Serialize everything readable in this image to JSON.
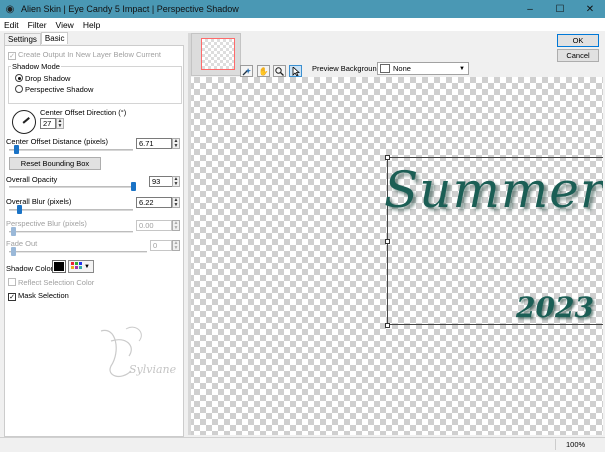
{
  "window": {
    "title": "Alien Skin | Eye Candy 5 Impact | Perspective Shadow",
    "minimize_icon": "minimize-icon",
    "maximize_icon": "maximize-icon",
    "close_icon": "close-icon"
  },
  "menu": {
    "items": [
      "Edit",
      "Filter",
      "View",
      "Help"
    ]
  },
  "tabs": [
    "Settings",
    "Basic"
  ],
  "basic": {
    "create_output_label": "Create Output In New Layer Below Current",
    "shadow_mode_label": "Shadow Mode",
    "drop_shadow_label": "Drop Shadow",
    "perspective_shadow_label": "Perspective Shadow",
    "shadow_mode_selected": "Drop Shadow",
    "center_offset_direction_label": "Center Offset Direction (°)",
    "center_offset_direction_value": "27",
    "center_offset_distance_label": "Center Offset Distance (pixels)",
    "center_offset_distance_value": "6.71",
    "reset_bounding_box_label": "Reset Bounding Box",
    "overall_opacity_label": "Overall Opacity",
    "overall_opacity_value": "93",
    "overall_blur_label": "Overall Blur (pixels)",
    "overall_blur_value": "6.22",
    "perspective_blur_label": "Perspective Blur (pixels)",
    "perspective_blur_value": "0.00",
    "fade_out_label": "Fade Out",
    "fade_out_value": "0",
    "shadow_color_label": "Shadow Color",
    "shadow_color": "#000000",
    "reflect_selection_color_label": "Reflect Selection Color",
    "mask_selection_label": "Mask Selection",
    "mask_selection_checked": true,
    "watermark_text": "Sylviane"
  },
  "toolbar": {
    "tools": [
      "wand-icon",
      "hand-icon",
      "zoom-icon",
      "arrow-icon"
    ],
    "preview_background_label": "Preview Background:",
    "preview_background_value": "None",
    "ok_label": "OK",
    "cancel_label": "Cancel"
  },
  "preview": {
    "title_word": "Summer",
    "year_word": "2023",
    "text_color": "#1b5e55"
  },
  "status": {
    "zoom": "100%"
  }
}
